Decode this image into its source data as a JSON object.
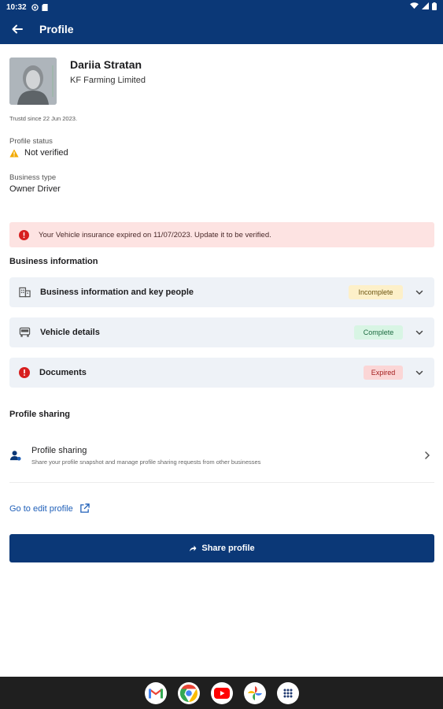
{
  "status_bar": {
    "time": "10:32"
  },
  "app_bar": {
    "title": "Profile"
  },
  "profile": {
    "name": "Dariia Stratan",
    "company": "KF Farming Limited",
    "trusted_since": "Trustd since 22 Jun 2023.",
    "status_label": "Profile status",
    "status_value": "Not verified",
    "business_type_label": "Business type",
    "business_type_value": "Owner Driver"
  },
  "alert": {
    "text": "Your Vehicle insurance expired on 11/07/2023. Update it to be verified."
  },
  "business_section": {
    "title": "Business information",
    "items": [
      {
        "label": "Business information and key people",
        "badge": "Incomplete",
        "badge_bg": "#fdf0c9",
        "badge_color": "#6b5410"
      },
      {
        "label": "Vehicle details",
        "badge": "Complete",
        "badge_bg": "#d8f5e4",
        "badge_color": "#1d6b41"
      },
      {
        "label": "Documents",
        "badge": "Expired",
        "badge_bg": "#fbd6d6",
        "badge_color": "#a31d1d"
      }
    ]
  },
  "sharing_section": {
    "title": "Profile sharing",
    "row_title": "Profile sharing",
    "row_subtitle": "Share your profile snapshot and manage profile sharing requests from other businesses"
  },
  "edit_link": "Go to edit profile",
  "share_button": "Share profile",
  "colors": {
    "primary": "#0b3877",
    "error": "#d71f1f",
    "warning": "#f2a900",
    "link": "#1f5fb8"
  },
  "nav_apps": [
    "gmail-icon",
    "chrome-icon",
    "youtube-icon",
    "photos-icon",
    "app-drawer-icon"
  ]
}
